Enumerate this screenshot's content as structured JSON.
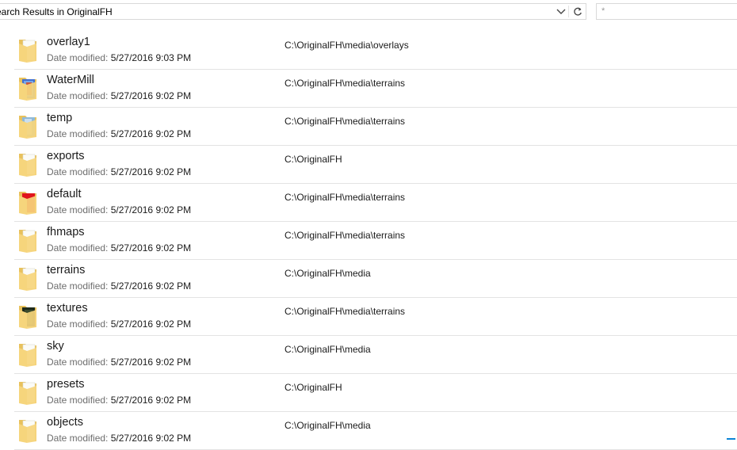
{
  "address_bar": {
    "text": "Search Results in OriginalFH",
    "chevron_icon": "chevron-down-icon",
    "refresh_icon": "refresh-icon"
  },
  "search": {
    "placeholder": "*"
  },
  "results": [
    {
      "name": "overlay1",
      "date_label": "Date modified:",
      "date": "5/27/2016 9:03 PM",
      "path": "C:\\OriginalFH\\media\\overlays",
      "thumb": "plain"
    },
    {
      "name": "WaterMill",
      "date_label": "Date modified:",
      "date": "5/27/2016 9:02 PM",
      "path": "C:\\OriginalFH\\media\\terrains",
      "thumb": "watermill"
    },
    {
      "name": "temp",
      "date_label": "Date modified:",
      "date": "5/27/2016 9:02 PM",
      "path": "C:\\OriginalFH\\media\\terrains",
      "thumb": "temp"
    },
    {
      "name": "exports",
      "date_label": "Date modified:",
      "date": "5/27/2016 9:02 PM",
      "path": "C:\\OriginalFH",
      "thumb": "plain"
    },
    {
      "name": "default",
      "date_label": "Date modified:",
      "date": "5/27/2016 9:02 PM",
      "path": "C:\\OriginalFH\\media\\terrains",
      "thumb": "default"
    },
    {
      "name": "fhmaps",
      "date_label": "Date modified:",
      "date": "5/27/2016 9:02 PM",
      "path": "C:\\OriginalFH\\media\\terrains",
      "thumb": "plain"
    },
    {
      "name": "terrains",
      "date_label": "Date modified:",
      "date": "5/27/2016 9:02 PM",
      "path": "C:\\OriginalFH\\media",
      "thumb": "plain"
    },
    {
      "name": "textures",
      "date_label": "Date modified:",
      "date": "5/27/2016 9:02 PM",
      "path": "C:\\OriginalFH\\media\\terrains",
      "thumb": "textures"
    },
    {
      "name": "sky",
      "date_label": "Date modified:",
      "date": "5/27/2016 9:02 PM",
      "path": "C:\\OriginalFH\\media",
      "thumb": "plain"
    },
    {
      "name": "presets",
      "date_label": "Date modified:",
      "date": "5/27/2016 9:02 PM",
      "path": "C:\\OriginalFH",
      "thumb": "plain"
    },
    {
      "name": "objects",
      "date_label": "Date modified:",
      "date": "5/27/2016 9:02 PM",
      "path": "C:\\OriginalFH\\media",
      "thumb": "plain"
    }
  ],
  "colors": {
    "folder_back": "#e8c15c",
    "folder_front": "#f6d57c",
    "paper": "#fbfbf7",
    "watermill_blue": "#3f6fd1",
    "default_red": "#e0141c",
    "textures_dark": "#1e2a1a",
    "temp_blue": "#8fb9d8",
    "accent": "#0a84d6"
  }
}
